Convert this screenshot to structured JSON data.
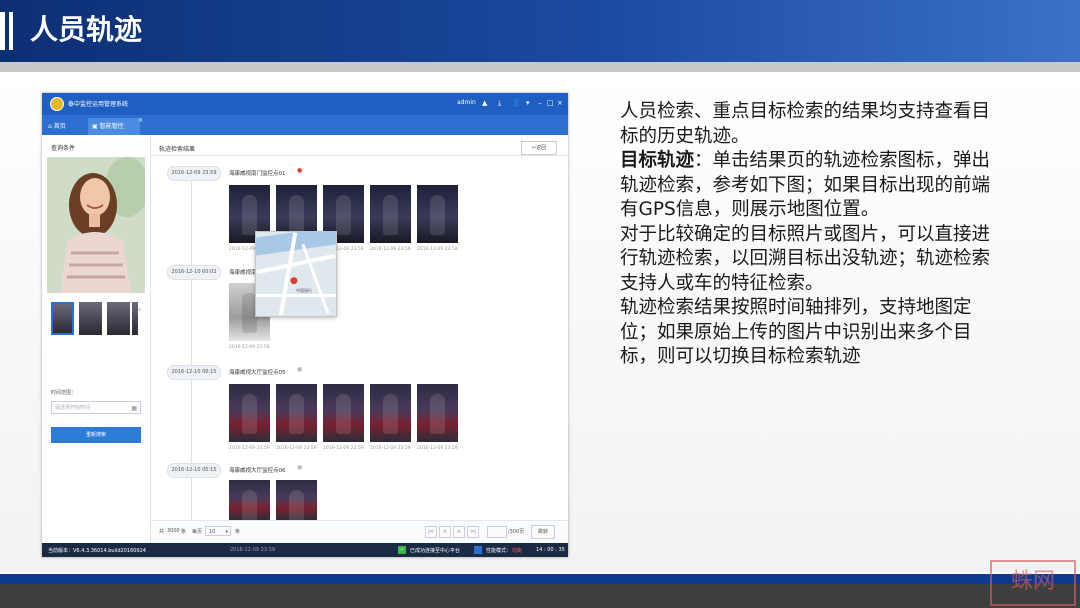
{
  "slide": {
    "title": "人员轨迹"
  },
  "app": {
    "name": "泰中监控运用管理系统",
    "user": "admin",
    "toolbar_icons": [
      "alert-icon",
      "download-icon",
      "user-icon",
      "filter-icon",
      "minimize-icon",
      "maximize-icon",
      "close-icon"
    ],
    "tabs": [
      {
        "label": "首页"
      },
      {
        "label": "智能管控"
      }
    ],
    "tab_close": "×",
    "left_panel": {
      "title": "查询条件",
      "time_label": "时间范围：",
      "time_placeholder": "请选择开始时间",
      "search_button": "重新搜索"
    },
    "main": {
      "title": "轨迹检索结果",
      "back_button": "返回",
      "groups": [
        {
          "time": "2016-12-09 23:59",
          "camera": "海康威视南门监控点01",
          "photos": [
            {
              "ts": "2016-12-09 23:59"
            },
            {
              "ts": "2016-12-09 23:59"
            },
            {
              "ts": "2016-12-09 23:59"
            },
            {
              "ts": "2016-12-09 23:59"
            },
            {
              "ts": "2016-12-09 23:59"
            }
          ]
        },
        {
          "time": "2016-12-10 00:02",
          "camera": "海康威视南门监控点02",
          "photos": [
            {
              "ts": "2016-12-09 23:59"
            }
          ]
        },
        {
          "time": "2016-12-10 00:15",
          "camera": "海康威视大厅监控点05",
          "photos": [
            {
              "ts": "2016-12-09 23:59"
            },
            {
              "ts": "2016-12-09 23:59"
            },
            {
              "ts": "2016-12-09 23:59"
            },
            {
              "ts": "2016-12-09 23:59"
            },
            {
              "ts": "2016-12-09 23:59"
            }
          ]
        },
        {
          "time": "2016-12-10 00:15",
          "camera": "海康威视大厅监控点06",
          "photos": [
            {
              "ts": ""
            },
            {
              "ts": ""
            }
          ]
        }
      ],
      "map_label": "中国银行"
    },
    "pager": {
      "total_prefix": "共",
      "total": "3000",
      "total_suffix": "条",
      "per_page_label": "每页",
      "per_page": "10",
      "per_page_suffix": "条",
      "buttons": [
        "|<",
        "<",
        ">",
        ">|"
      ],
      "pages_suffix": "/300页",
      "go_button": "跳转"
    },
    "status_bar": {
      "version": "当前版本：V6.4.3.36014.build20160924",
      "time_center": "2016-12-09 23:59",
      "connection": "已成功连接至中心平台",
      "mode_label": "性能模式：",
      "mode_value": "均衡",
      "clock": "14 : 00 : 35"
    }
  },
  "description": {
    "p1": "人员检索、重点目标检索的结果均支持查看目标的历史轨迹。",
    "p2_strong": "目标轨迹",
    "p2_rest": "：单击结果页的轨迹检索图标，弹出轨迹检索，参考如下图；如果目标出现的前端有GPS信息，则展示地图位置。",
    "p3": "对于比较确定的目标照片或图片，可以直接进行轨迹检索，以回溯目标出没轨迹；轨迹检索支持人或车的特征检索。",
    "p4": "轨迹检索结果按照时间轴排列，支持地图定位；如果原始上传的图片中识别出来多个目标，则可以切换目标检索轨迹"
  },
  "watermark": "蛛网"
}
